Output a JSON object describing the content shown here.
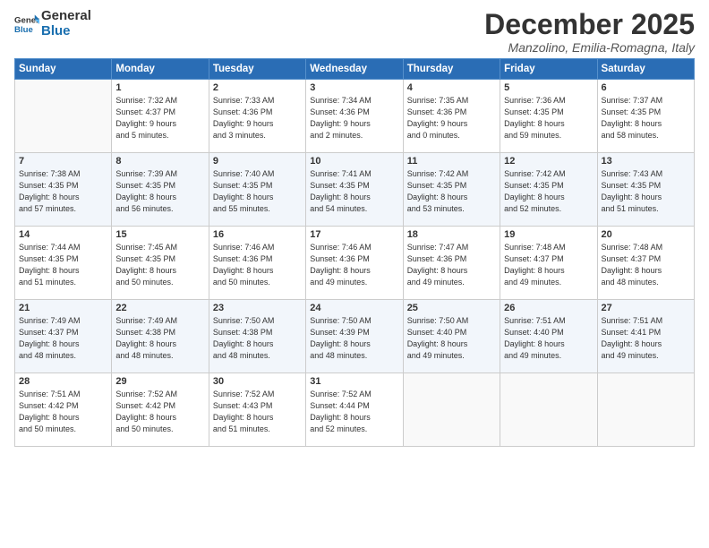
{
  "logo": {
    "general": "General",
    "blue": "Blue"
  },
  "title": "December 2025",
  "subtitle": "Manzolino, Emilia-Romagna, Italy",
  "days_header": [
    "Sunday",
    "Monday",
    "Tuesday",
    "Wednesday",
    "Thursday",
    "Friday",
    "Saturday"
  ],
  "weeks": [
    [
      {
        "day": "",
        "info": ""
      },
      {
        "day": "1",
        "info": "Sunrise: 7:32 AM\nSunset: 4:37 PM\nDaylight: 9 hours\nand 5 minutes."
      },
      {
        "day": "2",
        "info": "Sunrise: 7:33 AM\nSunset: 4:36 PM\nDaylight: 9 hours\nand 3 minutes."
      },
      {
        "day": "3",
        "info": "Sunrise: 7:34 AM\nSunset: 4:36 PM\nDaylight: 9 hours\nand 2 minutes."
      },
      {
        "day": "4",
        "info": "Sunrise: 7:35 AM\nSunset: 4:36 PM\nDaylight: 9 hours\nand 0 minutes."
      },
      {
        "day": "5",
        "info": "Sunrise: 7:36 AM\nSunset: 4:35 PM\nDaylight: 8 hours\nand 59 minutes."
      },
      {
        "day": "6",
        "info": "Sunrise: 7:37 AM\nSunset: 4:35 PM\nDaylight: 8 hours\nand 58 minutes."
      }
    ],
    [
      {
        "day": "7",
        "info": "Sunrise: 7:38 AM\nSunset: 4:35 PM\nDaylight: 8 hours\nand 57 minutes."
      },
      {
        "day": "8",
        "info": "Sunrise: 7:39 AM\nSunset: 4:35 PM\nDaylight: 8 hours\nand 56 minutes."
      },
      {
        "day": "9",
        "info": "Sunrise: 7:40 AM\nSunset: 4:35 PM\nDaylight: 8 hours\nand 55 minutes."
      },
      {
        "day": "10",
        "info": "Sunrise: 7:41 AM\nSunset: 4:35 PM\nDaylight: 8 hours\nand 54 minutes."
      },
      {
        "day": "11",
        "info": "Sunrise: 7:42 AM\nSunset: 4:35 PM\nDaylight: 8 hours\nand 53 minutes."
      },
      {
        "day": "12",
        "info": "Sunrise: 7:42 AM\nSunset: 4:35 PM\nDaylight: 8 hours\nand 52 minutes."
      },
      {
        "day": "13",
        "info": "Sunrise: 7:43 AM\nSunset: 4:35 PM\nDaylight: 8 hours\nand 51 minutes."
      }
    ],
    [
      {
        "day": "14",
        "info": "Sunrise: 7:44 AM\nSunset: 4:35 PM\nDaylight: 8 hours\nand 51 minutes."
      },
      {
        "day": "15",
        "info": "Sunrise: 7:45 AM\nSunset: 4:35 PM\nDaylight: 8 hours\nand 50 minutes."
      },
      {
        "day": "16",
        "info": "Sunrise: 7:46 AM\nSunset: 4:36 PM\nDaylight: 8 hours\nand 50 minutes."
      },
      {
        "day": "17",
        "info": "Sunrise: 7:46 AM\nSunset: 4:36 PM\nDaylight: 8 hours\nand 49 minutes."
      },
      {
        "day": "18",
        "info": "Sunrise: 7:47 AM\nSunset: 4:36 PM\nDaylight: 8 hours\nand 49 minutes."
      },
      {
        "day": "19",
        "info": "Sunrise: 7:48 AM\nSunset: 4:37 PM\nDaylight: 8 hours\nand 49 minutes."
      },
      {
        "day": "20",
        "info": "Sunrise: 7:48 AM\nSunset: 4:37 PM\nDaylight: 8 hours\nand 48 minutes."
      }
    ],
    [
      {
        "day": "21",
        "info": "Sunrise: 7:49 AM\nSunset: 4:37 PM\nDaylight: 8 hours\nand 48 minutes."
      },
      {
        "day": "22",
        "info": "Sunrise: 7:49 AM\nSunset: 4:38 PM\nDaylight: 8 hours\nand 48 minutes."
      },
      {
        "day": "23",
        "info": "Sunrise: 7:50 AM\nSunset: 4:38 PM\nDaylight: 8 hours\nand 48 minutes."
      },
      {
        "day": "24",
        "info": "Sunrise: 7:50 AM\nSunset: 4:39 PM\nDaylight: 8 hours\nand 48 minutes."
      },
      {
        "day": "25",
        "info": "Sunrise: 7:50 AM\nSunset: 4:40 PM\nDaylight: 8 hours\nand 49 minutes."
      },
      {
        "day": "26",
        "info": "Sunrise: 7:51 AM\nSunset: 4:40 PM\nDaylight: 8 hours\nand 49 minutes."
      },
      {
        "day": "27",
        "info": "Sunrise: 7:51 AM\nSunset: 4:41 PM\nDaylight: 8 hours\nand 49 minutes."
      }
    ],
    [
      {
        "day": "28",
        "info": "Sunrise: 7:51 AM\nSunset: 4:42 PM\nDaylight: 8 hours\nand 50 minutes."
      },
      {
        "day": "29",
        "info": "Sunrise: 7:52 AM\nSunset: 4:42 PM\nDaylight: 8 hours\nand 50 minutes."
      },
      {
        "day": "30",
        "info": "Sunrise: 7:52 AM\nSunset: 4:43 PM\nDaylight: 8 hours\nand 51 minutes."
      },
      {
        "day": "31",
        "info": "Sunrise: 7:52 AM\nSunset: 4:44 PM\nDaylight: 8 hours\nand 52 minutes."
      },
      {
        "day": "",
        "info": ""
      },
      {
        "day": "",
        "info": ""
      },
      {
        "day": "",
        "info": ""
      }
    ]
  ]
}
